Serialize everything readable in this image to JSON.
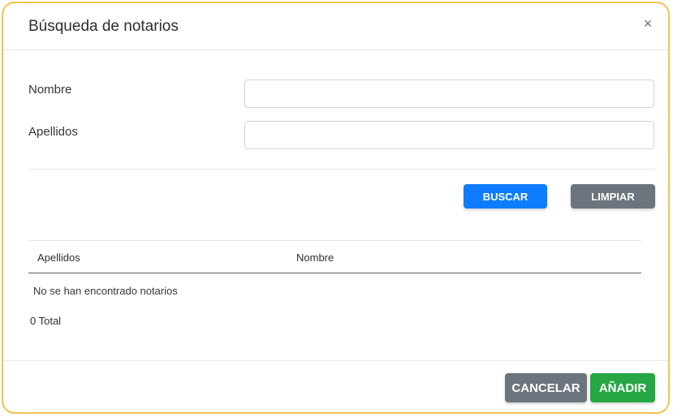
{
  "modal": {
    "title": "Búsqueda de notarios",
    "close_symbol": "×",
    "close_icon": "close-icon"
  },
  "form": {
    "nombre_label": "Nombre",
    "nombre_value": "",
    "apellidos_label": "Apellidos",
    "apellidos_value": ""
  },
  "actions": {
    "buscar_label": "BUSCAR",
    "limpiar_label": "LIMPIAR"
  },
  "table": {
    "columns": [
      "Apellidos",
      "Nombre"
    ],
    "rows": [],
    "empty_message": "No se han encontrado notarios",
    "total_text": "0 Total"
  },
  "footer": {
    "cancelar_label": "CANCELAR",
    "anadir_label": "AÑADIR"
  },
  "colors": {
    "frame_border": "#f5c24d",
    "primary": "#0d7cff",
    "secondary": "#6c757d",
    "success": "#27a744"
  }
}
